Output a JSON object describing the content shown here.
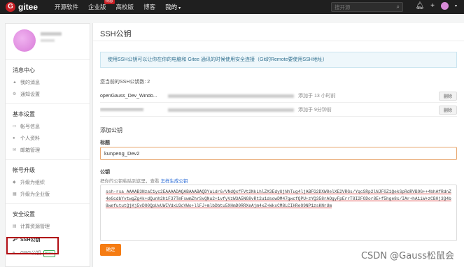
{
  "topbar": {
    "logo_mark": "G",
    "logo_text": "gitee",
    "nav": [
      {
        "label": "开源软件"
      },
      {
        "label": "企业版",
        "badge": "特惠"
      },
      {
        "label": "高校版"
      },
      {
        "label": "博客"
      },
      {
        "label": "我的",
        "caret": "▾"
      }
    ],
    "search_placeholder": "搜开源",
    "icons": [
      "search-icon",
      "bell-icon",
      "plus-icon",
      "avatar",
      "caret-down-icon"
    ]
  },
  "sidebar": {
    "sections": [
      {
        "title": "消息中心",
        "items": [
          {
            "label": "我的消息",
            "icon": "bell-icon"
          },
          {
            "label": "通知设置",
            "icon": "gear-icon"
          }
        ]
      },
      {
        "title": "基本设置",
        "items": [
          {
            "label": "帐号信息",
            "icon": "card-icon"
          },
          {
            "label": "个人资料",
            "icon": "user-icon"
          },
          {
            "label": "邮箱管理",
            "icon": "mail-icon"
          }
        ]
      },
      {
        "title": "帐号升级",
        "items": [
          {
            "label": "升级为组织",
            "icon": "org-icon"
          },
          {
            "label": "升级为企业版",
            "icon": "building-icon"
          }
        ]
      },
      {
        "title": "安全设置",
        "items": [
          {
            "label": "计算资源管理",
            "icon": "server-icon"
          },
          {
            "label": "SSH公钥",
            "icon": "key-icon"
          },
          {
            "label": "GPG公钥",
            "icon": "lock-icon",
            "badge": "Beta"
          }
        ]
      }
    ]
  },
  "main": {
    "title": "SSH公钥",
    "info": "使用SSH公钥可以让你在你的电脑和 Gitee 通讯的时候使用安全连接（Git的Remote要使用SSH地址）",
    "count_text": "您当前的SSH公钥数: 2",
    "keys": [
      {
        "name": "openGauss_Dev_Windo...",
        "added": "添加于 13 小时前",
        "delete_label": "删除"
      },
      {
        "name": "",
        "added": "添加于 9分钟前",
        "delete_label": "删除"
      }
    ],
    "add_title": "添加公钥",
    "title_label": "标题",
    "title_value": "kunpeng_Dev2",
    "key_label": "公钥",
    "hint_prefix": "把你的公钥粘贴到这里，查看",
    "hint_link": "怎样生成公钥",
    "key_value": "ssh-rsa AAAAB3NzaC1yc2EAAAADAQABAAABAQDYaLdr6/VNdQxfFVt2NkLhlZX3EdyUjNhTug4ljABFG2DXW8elXE2VRGs/YqcSRp2lNJF0Z1QekSpRdRVB9G++4bhAfRdnZ4eGcdbYvtwgZg4k+dQunh2h1F37TmFswmZhrSvQNu2+1vfyVzW3A5NG8vRt2u1dsowDM47gwcfQPU+zYQ358rAOgyFpErrT8I2FODor8E+f5hge8c/IAr+hA1iW+zCB0j3Q4b8wefututQjKj5vDO0QpUvUWIVdxU3cVWo+llFJ+mlbDbtu5XHmD0RRXeAjm4xZ+WkxCM8LCIHReO9NP1zsKNrUm",
    "confirm_label": "确定"
  },
  "watermark": "CSDN @Gauss松鼠会"
}
